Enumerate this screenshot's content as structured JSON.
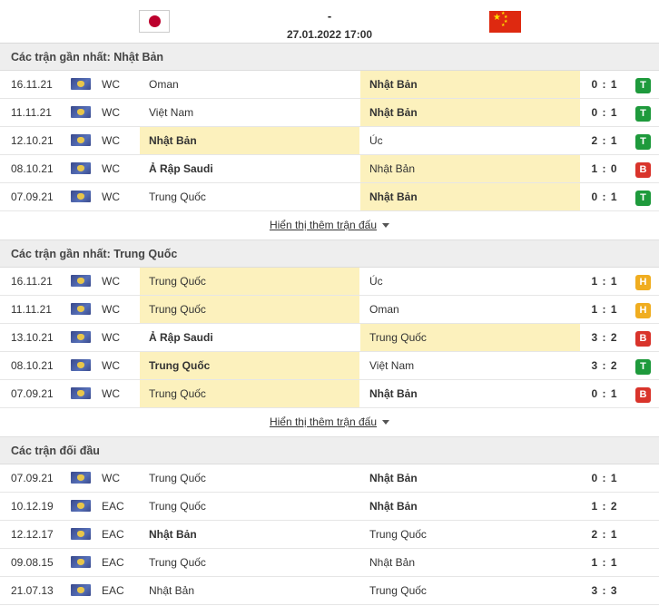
{
  "header": {
    "score": "-",
    "datetime": "27.01.2022 17:00",
    "home_flag": "japan-flag",
    "away_flag": "china-flag"
  },
  "colors": {
    "highlight": "#fcf1bd",
    "win": "#1e9a3c",
    "loss": "#d9342b",
    "draw": "#f0ad20"
  },
  "sections": [
    {
      "title": "Các trận gần nhất: Nhật Bản",
      "show_more": "Hiển thị thêm trận đấu",
      "rows": [
        {
          "date": "16.11.21",
          "comp": "WC",
          "home": "Oman",
          "away": "Nhật Bản",
          "score": "0 : 1",
          "result": "T",
          "hl": "away",
          "win": "away"
        },
        {
          "date": "11.11.21",
          "comp": "WC",
          "home": "Việt Nam",
          "away": "Nhật Bản",
          "score": "0 : 1",
          "result": "T",
          "hl": "away",
          "win": "away"
        },
        {
          "date": "12.10.21",
          "comp": "WC",
          "home": "Nhật Bản",
          "away": "Úc",
          "score": "2 : 1",
          "result": "T",
          "hl": "home",
          "win": "home"
        },
        {
          "date": "08.10.21",
          "comp": "WC",
          "home": "Ả Rập Saudi",
          "away": "Nhật Bản",
          "score": "1 : 0",
          "result": "B",
          "hl": "away",
          "win": "home"
        },
        {
          "date": "07.09.21",
          "comp": "WC",
          "home": "Trung Quốc",
          "away": "Nhật Bản",
          "score": "0 : 1",
          "result": "T",
          "hl": "away",
          "win": "away"
        }
      ]
    },
    {
      "title": "Các trận gần nhất: Trung Quốc",
      "show_more": "Hiển thị thêm trận đấu",
      "rows": [
        {
          "date": "16.11.21",
          "comp": "WC",
          "home": "Trung Quốc",
          "away": "Úc",
          "score": "1 : 1",
          "result": "H",
          "hl": "home",
          "win": ""
        },
        {
          "date": "11.11.21",
          "comp": "WC",
          "home": "Trung Quốc",
          "away": "Oman",
          "score": "1 : 1",
          "result": "H",
          "hl": "home",
          "win": ""
        },
        {
          "date": "13.10.21",
          "comp": "WC",
          "home": "Ả Rập Saudi",
          "away": "Trung Quốc",
          "score": "3 : 2",
          "result": "B",
          "hl": "away",
          "win": "home"
        },
        {
          "date": "08.10.21",
          "comp": "WC",
          "home": "Trung Quốc",
          "away": "Việt Nam",
          "score": "3 : 2",
          "result": "T",
          "hl": "home",
          "win": "home"
        },
        {
          "date": "07.09.21",
          "comp": "WC",
          "home": "Trung Quốc",
          "away": "Nhật Bản",
          "score": "0 : 1",
          "result": "B",
          "hl": "home",
          "win": "away"
        }
      ]
    },
    {
      "title": "Các trận đối đầu",
      "show_more": "",
      "rows": [
        {
          "date": "07.09.21",
          "comp": "WC",
          "home": "Trung Quốc",
          "away": "Nhật Bản",
          "score": "0 : 1",
          "result": "",
          "hl": "",
          "win": "away"
        },
        {
          "date": "10.12.19",
          "comp": "EAC",
          "home": "Trung Quốc",
          "away": "Nhật Bản",
          "score": "1 : 2",
          "result": "",
          "hl": "",
          "win": "away"
        },
        {
          "date": "12.12.17",
          "comp": "EAC",
          "home": "Nhật Bản",
          "away": "Trung Quốc",
          "score": "2 : 1",
          "result": "",
          "hl": "",
          "win": "home"
        },
        {
          "date": "09.08.15",
          "comp": "EAC",
          "home": "Trung Quốc",
          "away": "Nhật Bản",
          "score": "1 : 1",
          "result": "",
          "hl": "",
          "win": ""
        },
        {
          "date": "21.07.13",
          "comp": "EAC",
          "home": "Nhật Bản",
          "away": "Trung Quốc",
          "score": "3 : 3",
          "result": "",
          "hl": "",
          "win": ""
        }
      ]
    }
  ]
}
